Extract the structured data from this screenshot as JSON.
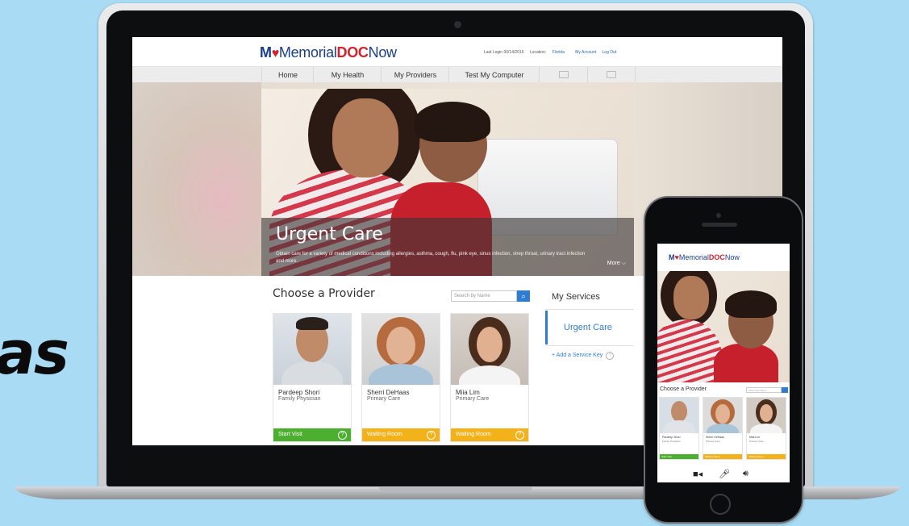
{
  "background_text": "as",
  "logo": {
    "mo": "M",
    "heart": "♥",
    "memorial": "Memorial",
    "doc": "DOC",
    "now": "Now"
  },
  "top_links": {
    "last_login": "Last Login 00/14/2016",
    "location_label": "Location: ",
    "location_value": "Florida",
    "my_account": "My Account",
    "log_out": "Log Out"
  },
  "nav": {
    "items": [
      "Home",
      "My Health",
      "My Providers",
      "Test My Computer"
    ],
    "icons": [
      "calendar-icon",
      "mail-icon"
    ]
  },
  "hero": {
    "title": "Urgent Care",
    "description": "Obtain care for a variety of medical conditions including allergies, asthma, cough, flu, pink eye, sinus infection, strep throat, urinary tract infection and more.",
    "more": "More ⌵"
  },
  "providers": {
    "title": "Choose a Provider",
    "search_placeholder": "Search by Name",
    "cards": [
      {
        "name": "Pardeep Shori",
        "role": "Family Physician",
        "action": "Start Visit",
        "color": "#4caf2f"
      },
      {
        "name": "Sherri DeHaas",
        "role": "Primary Care",
        "action": "Waiting Room",
        "color": "#f3b11a"
      },
      {
        "name": "Miia Lim",
        "role": "Primary Care",
        "action": "Waiting Room",
        "color": "#f3b11a"
      }
    ]
  },
  "services": {
    "title": "My Services",
    "item": "Urgent Care",
    "add": "+ Add a Service Key",
    "help": "?"
  },
  "phone": {
    "logo": {
      "mo": "M",
      "heart": "♥",
      "memorial": "Memorial",
      "doc": "DOC",
      "now": "Now"
    },
    "title": "Choose a Provider",
    "search_placeholder": "Search by Name",
    "cards": [
      {
        "name": "Pardeep Shori",
        "role": "Family Physician",
        "action": "Start Visit"
      },
      {
        "name": "Sherri DeHaas",
        "role": "Primary Care",
        "action": "Waiting Room"
      },
      {
        "name": "Miia Lim",
        "role": "Primary Care",
        "action": "Waiting Room"
      }
    ],
    "controls": {
      "video": "■◂",
      "mic": "🎤︎",
      "speaker": "🔊︎"
    }
  },
  "colors": {
    "accent_blue": "#2f7dd1",
    "brand_red": "#d0232c",
    "brand_navy": "#1a3e8c",
    "start_green": "#4caf2f",
    "waiting_yellow": "#f3b11a"
  }
}
